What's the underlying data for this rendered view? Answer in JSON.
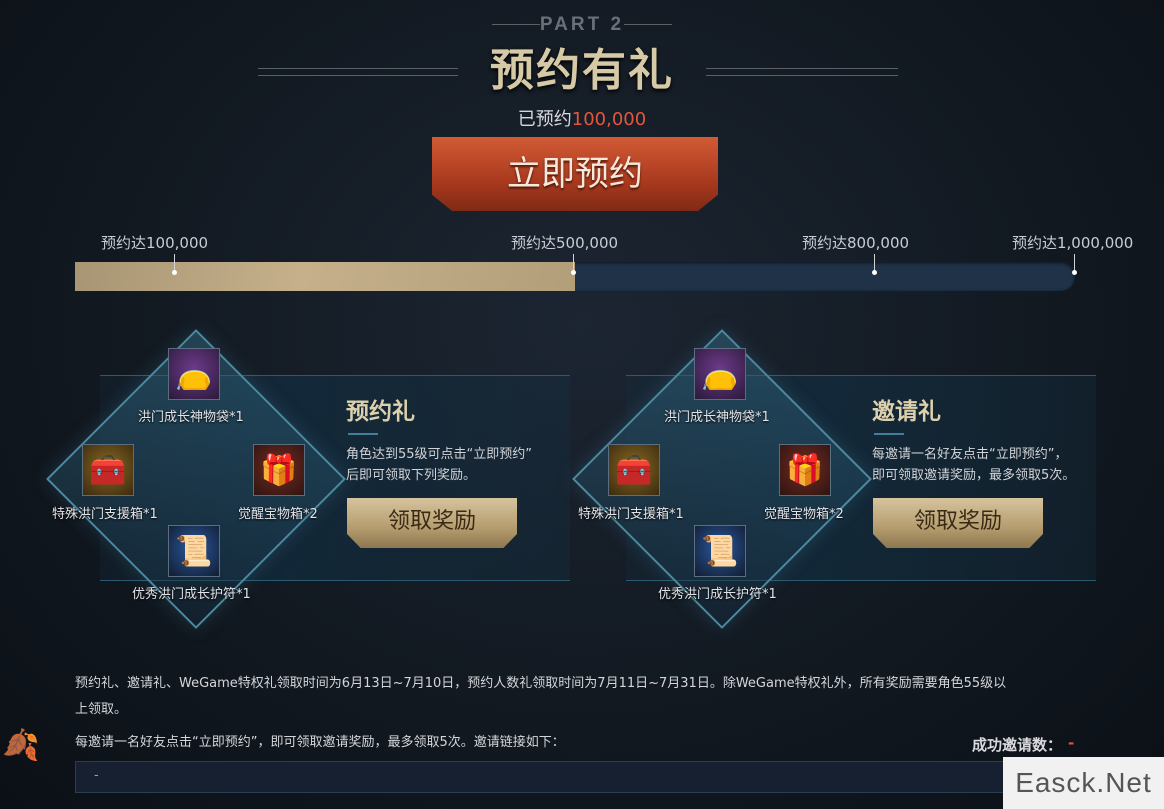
{
  "header": {
    "part_label": "PART 2",
    "title": "预约有礼",
    "reserved_prefix": "已预约",
    "reserved_count": "100,000",
    "reserve_button": "立即预约"
  },
  "progress": {
    "milestones": [
      "预约达100,000",
      "预约达500,000",
      "预约达800,000",
      "预约达1,000,000"
    ],
    "fill_fraction": 0.5
  },
  "panels": [
    {
      "title": "预约礼",
      "desc_line1": "角色达到55级可点击“立即预约”",
      "desc_line2": "后即可领取下列奖励。",
      "button": "领取奖励",
      "items": [
        "洪门成长神物袋*1",
        "特殊洪门支援箱*1",
        "觉醒宝物箱*2",
        "优秀洪门成长护符*1"
      ]
    },
    {
      "title": "邀请礼",
      "desc_line1": "每邀请一名好友点击“立即预约”，",
      "desc_line2": "即可领取邀请奖励，最多领取5次。",
      "button": "领取奖励",
      "items": [
        "洪门成长神物袋*1",
        "特殊洪门支援箱*1",
        "觉醒宝物箱*2",
        "优秀洪门成长护符*1"
      ]
    }
  ],
  "notes": {
    "line1": "预约礼、邀请礼、WeGame特权礼领取时间为6月13日~7月10日，预约人数礼领取时间为7月11日~7月31日。除WeGame特权礼外，所有奖励需要角色55级以",
    "line2": "上领取。",
    "line3": "每邀请一名好友点击“立即预约”，即可领取邀请奖励，最多领取5次。邀请链接如下：",
    "invite_count_label": "成功邀请数：",
    "invite_count_value": "-",
    "invite_link": "-"
  },
  "watermark": "Easck.Net",
  "colors": {
    "accent_red": "#e6553a",
    "gold": "#c5b08b",
    "bar_track": "#1f3247"
  },
  "icons": [
    "treasure-bag-icon",
    "gold-chest-icon",
    "red-chest-icon",
    "blue-talisman-icon",
    "maple-leaf-icon"
  ]
}
